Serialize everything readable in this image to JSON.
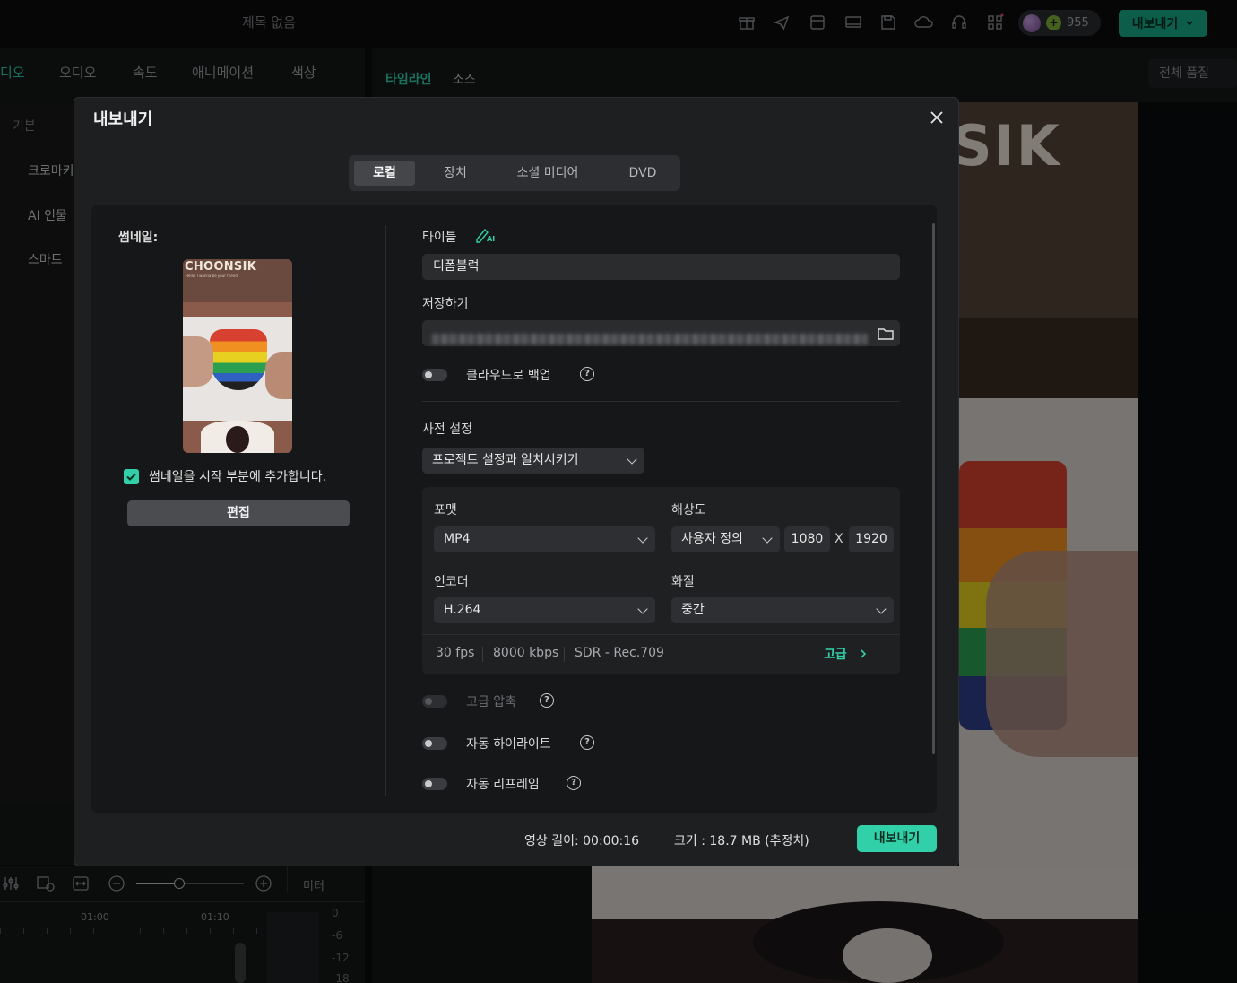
{
  "topbar": {
    "title": "제목 없음",
    "credits": "955",
    "export_label": "내보내기"
  },
  "left_panel": {
    "tabs": [
      "디오",
      "오디오",
      "속도",
      "애니메이션",
      "색상"
    ],
    "section": "기본",
    "items": [
      "크로마키",
      "AI 인물",
      "스마트"
    ]
  },
  "right_panel": {
    "tabs": [
      "타임라인",
      "소스"
    ],
    "quality": "전체 품질",
    "preview_text": "SIK"
  },
  "bottom": {
    "meter_label": "미터",
    "ruler": [
      "01:00",
      "01:10"
    ],
    "db": [
      "0",
      "-6",
      "-12",
      "-18"
    ]
  },
  "dialog": {
    "title": "내보내기",
    "tabs": [
      "로컬",
      "장치",
      "소셜 미디어",
      "DVD"
    ],
    "active_tab": "로컬",
    "thumbnail_label": "썸네일:",
    "thumbnail_brand": "CHOONSIK",
    "thumbnail_caption": "Hello, I wanna be your friend.",
    "add_thumbnail_label": "썸네일을 시작 부분에 추가합니다.",
    "add_thumbnail_checked": true,
    "edit_button": "편집",
    "title_label": "타이틀",
    "ai_badge": "AI",
    "title_value": "디폼블럭",
    "save_label": "저장하기",
    "cloud_backup_label": "클라우드로 백업",
    "preset_label": "사전 설정",
    "preset_value": "프로젝트 설정과 일치시키기",
    "format_label": "포맷",
    "format_value": "MP4",
    "resolution_label": "해상도",
    "resolution_value": "사용자 정의",
    "res_width": "1080",
    "res_x": "X",
    "res_height": "1920",
    "encoder_label": "인코더",
    "encoder_value": "H.264",
    "quality_label": "화질",
    "quality_value": "중간",
    "fps": "30 fps",
    "bitrate": "8000 kbps",
    "color": "SDR - Rec.709",
    "advanced_label": "고급",
    "adv_compress_label": "고급 압축",
    "auto_highlight_label": "자동 하이라이트",
    "auto_reframe_label": "자동 리프레임",
    "duration": "영상 길이: 00:00:16",
    "size": "크기 :  18.7 MB (추정치)",
    "export_button": "내보내기",
    "accent_color": "#31d0a8"
  }
}
